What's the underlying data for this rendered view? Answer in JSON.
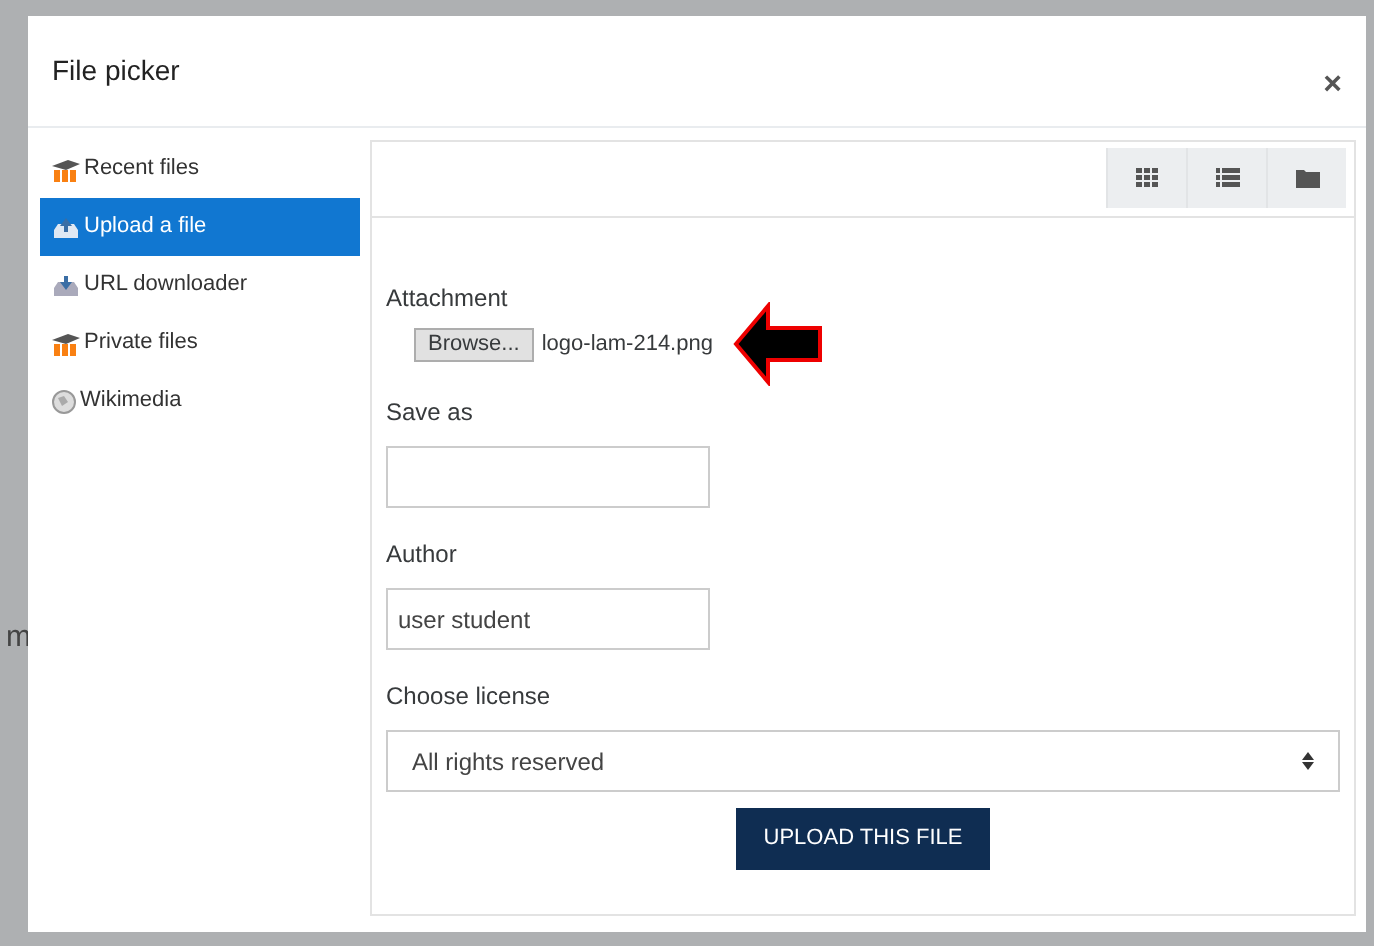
{
  "background": {
    "text": "m"
  },
  "window": {
    "title": "File picker",
    "close": "×"
  },
  "sidebar": {
    "items": [
      {
        "label": "Recent files",
        "kind": "moodle",
        "selected": false
      },
      {
        "label": "Upload a file",
        "kind": "upload",
        "selected": true
      },
      {
        "label": "URL downloader",
        "kind": "url",
        "selected": false
      },
      {
        "label": "Private files",
        "kind": "moodle",
        "selected": false
      },
      {
        "label": "Wikimedia",
        "kind": "globe",
        "selected": false
      }
    ]
  },
  "toolbar": {
    "views": [
      {
        "kind": "icons"
      },
      {
        "kind": "list"
      },
      {
        "kind": "tree"
      }
    ]
  },
  "form": {
    "attachment": {
      "label": "Attachment",
      "button": "Browse...",
      "filename": "logo-lam-214.png"
    },
    "save_as": {
      "label": "Save as"
    },
    "author": {
      "label": "Author",
      "value": "user student"
    },
    "license": {
      "label": "Choose license",
      "value": "All rights reserved"
    },
    "submit": "UPLOAD THIS FILE"
  }
}
